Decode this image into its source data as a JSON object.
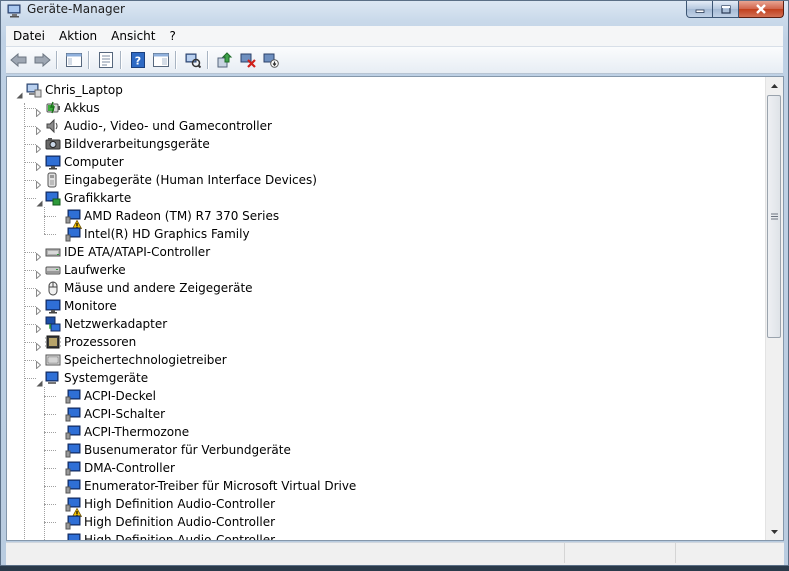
{
  "window": {
    "title": "Geräte-Manager"
  },
  "menu": [
    "Datei",
    "Aktion",
    "Ansicht",
    "?"
  ],
  "toolbar": {
    "buttons": [
      "back-icon",
      "forward-icon",
      "show-hide-console-tree-icon",
      "properties-icon",
      "help-icon",
      "action-pane-icon",
      "scan-hardware-icon",
      "update-driver-icon",
      "uninstall-icon",
      "disable-icon"
    ]
  },
  "tree": {
    "root": "Chris_Laptop",
    "categories": [
      {
        "label": "Akkus",
        "expanded": false,
        "icon": "battery-icon"
      },
      {
        "label": "Audio-, Video- und Gamecontroller",
        "expanded": false,
        "icon": "speaker-icon"
      },
      {
        "label": "Bildverarbeitungsgeräte",
        "expanded": false,
        "icon": "camera-icon"
      },
      {
        "label": "Computer",
        "expanded": false,
        "icon": "monitor-icon"
      },
      {
        "label": "Eingabegeräte (Human Interface Devices)",
        "expanded": false,
        "icon": "hid-icon"
      },
      {
        "label": "Grafikkarte",
        "expanded": true,
        "icon": "display-adapter-icon",
        "children": [
          {
            "label": "AMD Radeon (TM) R7 370 Series",
            "warning": true
          },
          {
            "label": "Intel(R) HD Graphics Family",
            "warning": false
          }
        ]
      },
      {
        "label": "IDE ATA/ATAPI-Controller",
        "expanded": false,
        "icon": "ide-icon"
      },
      {
        "label": "Laufwerke",
        "expanded": false,
        "icon": "drive-icon"
      },
      {
        "label": "Mäuse und andere Zeigegeräte",
        "expanded": false,
        "icon": "mouse-icon"
      },
      {
        "label": "Monitore",
        "expanded": false,
        "icon": "monitor-icon"
      },
      {
        "label": "Netzwerkadapter",
        "expanded": false,
        "icon": "network-icon"
      },
      {
        "label": "Prozessoren",
        "expanded": false,
        "icon": "processor-icon"
      },
      {
        "label": "Speichertechnologietreiber",
        "expanded": false,
        "icon": "storage-icon"
      },
      {
        "label": "Systemgeräte",
        "expanded": true,
        "icon": "system-device-icon",
        "children": [
          {
            "label": "ACPI-Deckel",
            "warning": false
          },
          {
            "label": "ACPI-Schalter",
            "warning": false
          },
          {
            "label": "ACPI-Thermozone",
            "warning": false
          },
          {
            "label": "Busenumerator für Verbundgeräte",
            "warning": false
          },
          {
            "label": "DMA-Controller",
            "warning": false
          },
          {
            "label": "Enumerator-Treiber für Microsoft Virtual Drive",
            "warning": false
          },
          {
            "label": "High Definition Audio-Controller",
            "warning": true
          },
          {
            "label": "High Definition Audio-Controller",
            "warning": false
          },
          {
            "label": "High Definition Audio-Controller",
            "warning": false
          }
        ]
      }
    ]
  },
  "colors": {
    "warning": "#f5c400",
    "device_blue": "#1d4fa8",
    "tree_line": "#a0a0a0"
  }
}
